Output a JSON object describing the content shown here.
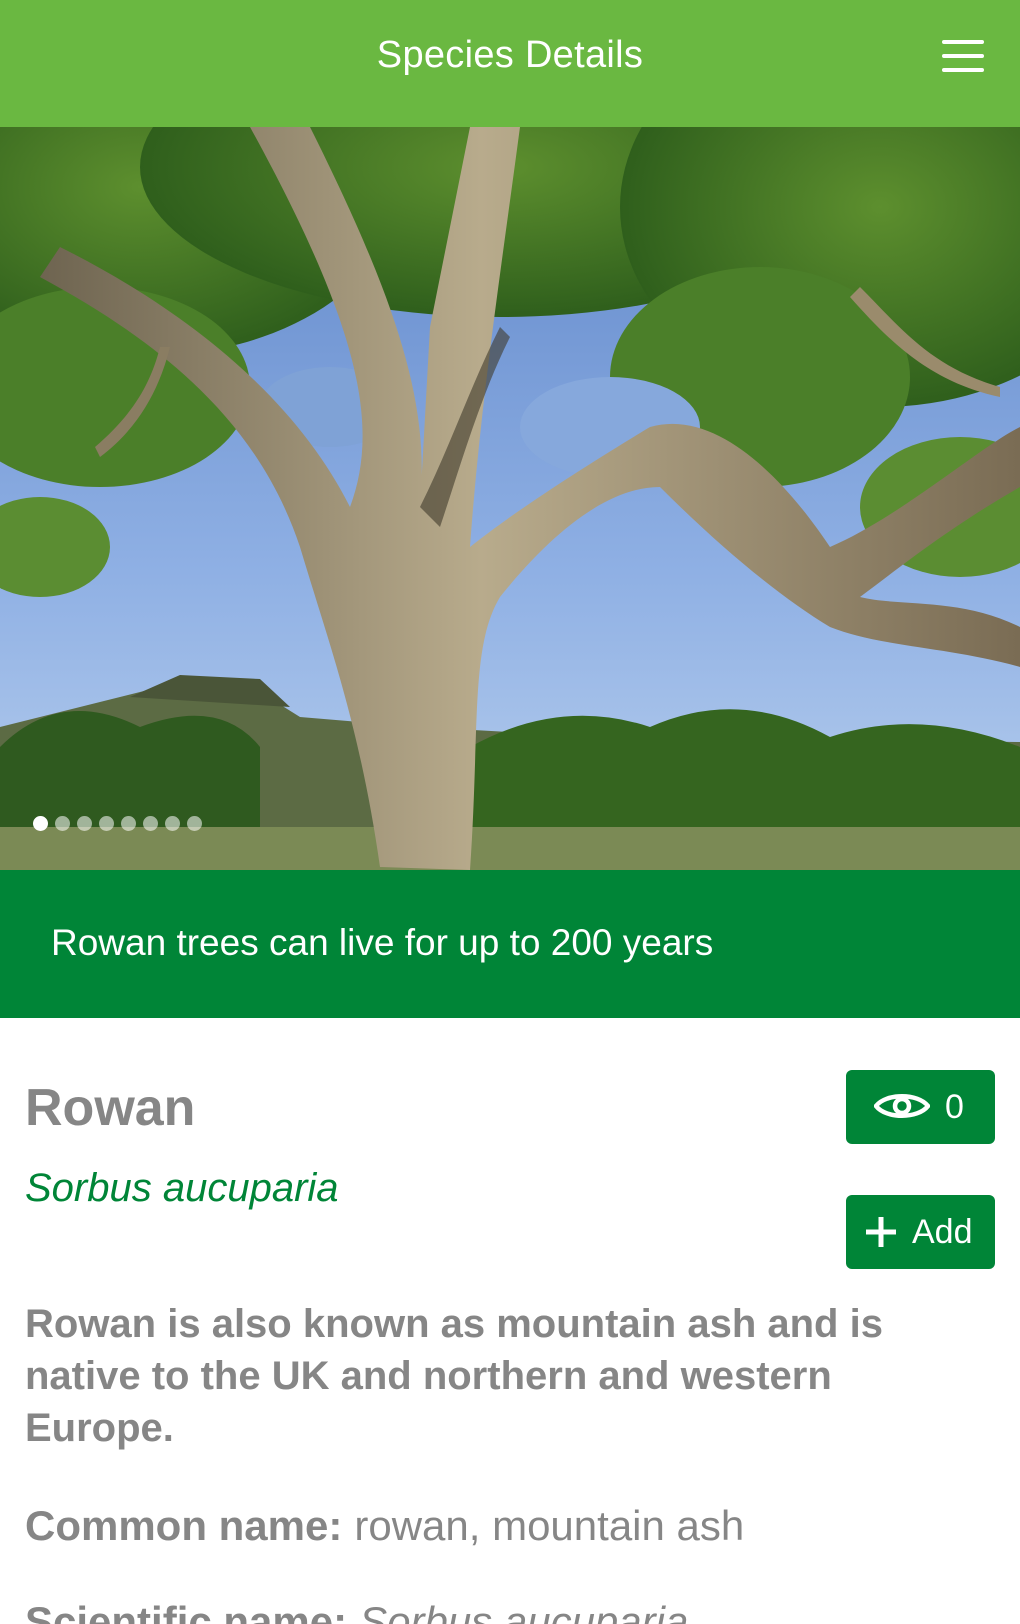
{
  "header": {
    "title": "Species Details",
    "menu_icon": "hamburger-menu-icon",
    "background": "#6ab841"
  },
  "hero": {
    "image_subject": "rowan-tree-photo",
    "slide_count": 8,
    "active_slide": 1
  },
  "caption": {
    "text": "Rowan trees can live for up to 200 years",
    "background": "#008537"
  },
  "species": {
    "name": "Rowan",
    "scientific_name": "Sorbus aucuparia",
    "sightings": {
      "icon": "eye-icon",
      "count": "0"
    },
    "add_button": {
      "icon": "plus-icon",
      "label": "Add"
    },
    "description": "Rowan is also known as mountain ash and is native to the UK and northern and western Europe.",
    "facts": [
      {
        "label": "Common name:",
        "value": "rowan, mountain ash"
      },
      {
        "label": "Scientific name:",
        "value": "Sorbus aucuparia"
      }
    ]
  },
  "colors": {
    "accent_green": "#008537",
    "header_green": "#6ab841",
    "text_grey": "#868686"
  }
}
